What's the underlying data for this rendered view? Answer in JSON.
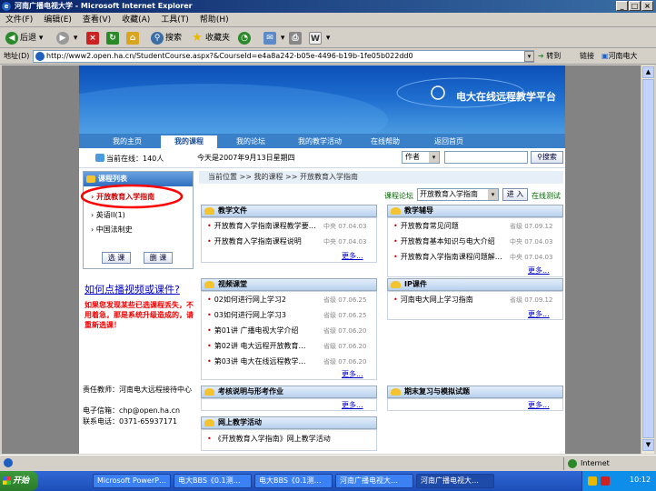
{
  "window": {
    "title": "河南广播电视大学 - Microsoft Internet Explorer"
  },
  "menu": [
    "文件(F)",
    "编辑(E)",
    "查看(V)",
    "收藏(A)",
    "工具(T)",
    "帮助(H)"
  ],
  "toolbar": {
    "back": "后退",
    "search": "搜索",
    "favorites": "收藏夹"
  },
  "address": {
    "label": "地址(D)",
    "url": "http://www2.open.ha.cn/StudentCourse.aspx?&CourseId=e4a8a242-b05e-4496-b19b-1fe05b022dd0",
    "go": "转到",
    "links": "链接",
    "links_item": "河南电大"
  },
  "banner": {
    "title": "电大在线远程教学平台"
  },
  "nav": [
    "我的主页",
    "我的课程",
    "我的论坛",
    "我的教学活动",
    "在线帮助",
    "返回首页"
  ],
  "info": {
    "online": "当前在线：140人",
    "date": "今天是2007年9月13日星期四",
    "search_select": "作者",
    "search_button": "搜索"
  },
  "breadcrumb": "当前位置 >> 我的课程 >> 开放教育入学指南",
  "sidebar": {
    "header": "课程列表",
    "courses": [
      "开放教育入学指南",
      "英语II(1)",
      "中国法制史"
    ],
    "btn_select": "选 课",
    "btn_delete": "删 课",
    "video_help": "如何点播视频或课件?",
    "warning": "如果您发现某些已选课程丢失，不用着急，那是系统升级造成的，请重新选课！",
    "teacher": "责任教师：河南电大远程接待中心",
    "email": "电子信箱：chp@open.ha.cn",
    "phone": "联系电话：0371-65937171"
  },
  "course_bar": {
    "forum": "课程论坛",
    "select": "开放教育入学指南",
    "enter": "进 入",
    "test": "在线测试"
  },
  "boxes": {
    "teaching_docs": {
      "title": "教学文件",
      "items": [
        {
          "t": "开放教育入学指南课程教学要…",
          "s": "中央",
          "d": "07.04.03"
        },
        {
          "t": "开放教育入学指南课程说明",
          "s": "中央",
          "d": "07.04.03"
        }
      ]
    },
    "tutoring": {
      "title": "教学辅导",
      "items": [
        {
          "t": "开放教育常见问题",
          "s": "省级",
          "d": "07.09.12"
        },
        {
          "t": "开放教育基本知识与电大介绍",
          "s": "中央",
          "d": "07.04.03"
        },
        {
          "t": "开放教育入学指南课程问题解…",
          "s": "中央",
          "d": "07.04.03"
        }
      ]
    },
    "video": {
      "title": "视频课堂",
      "items": [
        {
          "t": "02如何进行网上学习2",
          "s": "省级",
          "d": "07.06.25"
        },
        {
          "t": "03如何进行网上学习3",
          "s": "省级",
          "d": "07.06.25"
        },
        {
          "t": "第01讲  广播电视大学介绍",
          "s": "省级",
          "d": "07.06.20"
        },
        {
          "t": "第02讲  电大远程开放教育…",
          "s": "省级",
          "d": "07.06.20"
        },
        {
          "t": "第03讲  电大在线远程教学…",
          "s": "省级",
          "d": "07.06.20"
        }
      ]
    },
    "ip": {
      "title": "IP课件",
      "items": [
        {
          "t": "河南电大网上学习指南",
          "s": "省级",
          "d": "07.09.12"
        }
      ]
    },
    "exam": {
      "title": "考核说明与形考作业"
    },
    "review": {
      "title": "期末复习与模拟试题"
    },
    "activity": {
      "title": "网上教学活动",
      "items": [
        {
          "t": "《开放教育入学指南》网上教学活动"
        }
      ]
    },
    "more": "更多..."
  },
  "status": {
    "zone": "Internet"
  },
  "taskbar": {
    "start": "开始",
    "tasks": [
      "Microsoft PowerP…",
      "电大BBS《0.1测…",
      "电大BBS《0.1测…",
      "河南广播电视大…",
      "河南广播电视大…"
    ],
    "clock": "10:12"
  },
  "colors": {
    "titlebar": "#0a246a",
    "banner": "#1f6fd0",
    "nav": "#3a80c8",
    "highlight": "#ff0000"
  }
}
